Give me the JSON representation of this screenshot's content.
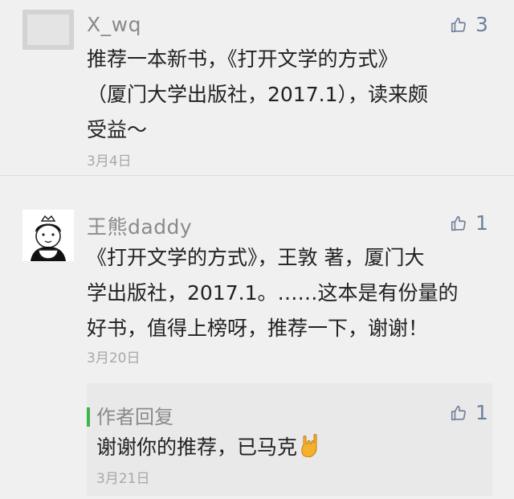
{
  "comments": [
    {
      "nickname": "X_wq",
      "likes": "3",
      "text_lines": [
        "推荐一本新书，《打开文学的方式》",
        "（厦门大学出版社，2017.1），读来颇",
        "受益～"
      ],
      "date": "3月4日"
    },
    {
      "nickname": "王熊daddy",
      "likes": "1",
      "text_lines": [
        "《打开文学的方式》，王敦 著，厦门大",
        "学出版社，2017.1。……这本是有份量的",
        "好书，值得上榜呀，推荐一下，谢谢！"
      ],
      "date": "3月20日",
      "reply": {
        "author": "作者回复",
        "likes": "1",
        "text": "谢谢你的推荐，已马克",
        "date": "3月21日"
      }
    }
  ],
  "icons": {
    "like": "thumbs-up-icon",
    "emoji": "rock-hand-icon"
  },
  "colors": {
    "like": "#6f7f9a",
    "reply_bar": "#3db64c",
    "text": "#222222",
    "meta": "#a8a8a8"
  }
}
